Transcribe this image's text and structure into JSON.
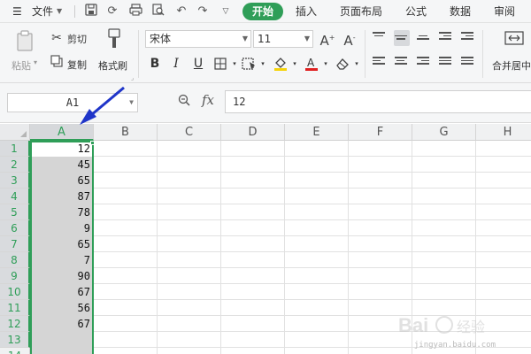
{
  "menubar": {
    "file_label": "文件",
    "tabs": [
      "开始",
      "插入",
      "页面布局",
      "公式",
      "数据",
      "审阅"
    ]
  },
  "ribbon": {
    "paste_label": "粘贴",
    "cut_label": "剪切",
    "copy_label": "复制",
    "format_painter_label": "格式刷",
    "font_name": "宋体",
    "font_size": "11",
    "merge_label": "合并居中"
  },
  "formula_bar": {
    "name_box": "A1",
    "fx_label": "fx",
    "value": "12"
  },
  "sheet": {
    "columns": [
      "A",
      "B",
      "C",
      "D",
      "E",
      "F",
      "G",
      "H"
    ],
    "rows": [
      "1",
      "2",
      "3",
      "4",
      "5",
      "6",
      "7",
      "8",
      "9",
      "10",
      "11",
      "12",
      "13",
      "14"
    ],
    "column_a_values": [
      "12",
      "45",
      "65",
      "87",
      "78",
      "9",
      "65",
      "7",
      "90",
      "67",
      "56",
      "67",
      "",
      ""
    ]
  },
  "watermark": {
    "text": "jingyan.baidu.com"
  },
  "colors": {
    "accent": "#2f9e58",
    "arrow": "#1f35c9"
  }
}
